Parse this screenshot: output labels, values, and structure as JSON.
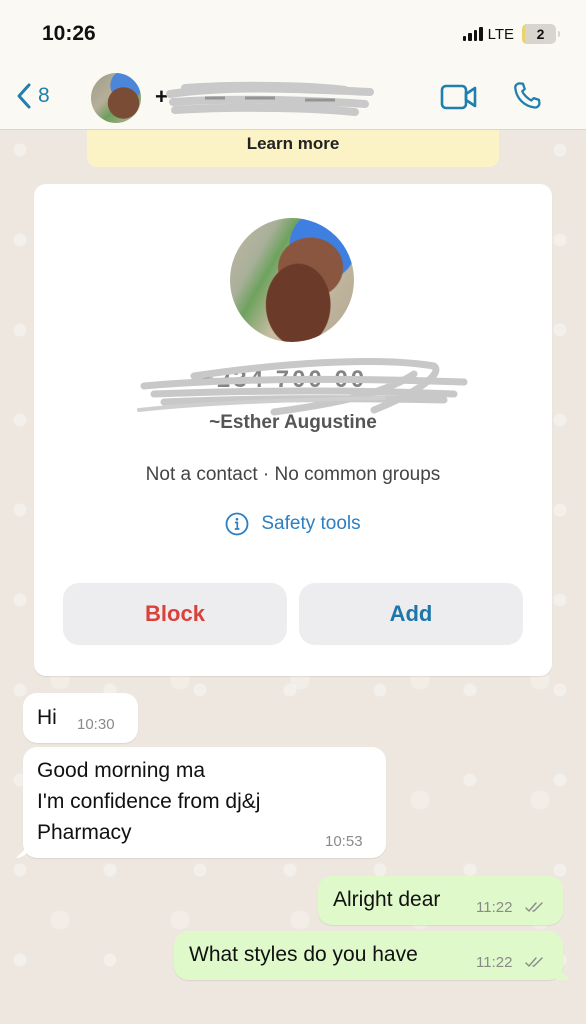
{
  "status_bar": {
    "time": "10:26",
    "network": "LTE",
    "battery_label": "2"
  },
  "header": {
    "back_count": "8",
    "contact_number_visible_prefix": "+",
    "contact_number_redacted_hint": "234 700 ··· ···",
    "accent_color": "#1F7FAE"
  },
  "banner": {
    "learn_more": "Learn more"
  },
  "contact_card": {
    "number_redacted_hint": "+234 700 00 ···",
    "name": "~Esther Augustine",
    "subtitle": "Not a contact · No common groups",
    "safety_tools": "Safety tools",
    "block_label": "Block",
    "add_label": "Add"
  },
  "messages": [
    {
      "direction": "in",
      "text": "Hi",
      "time": "10:30"
    },
    {
      "direction": "in",
      "lines": [
        "Good morning ma",
        "I'm confidence from dj&j",
        "Pharmacy"
      ],
      "time": "10:53"
    },
    {
      "direction": "out",
      "text": "Alright dear",
      "time": "11:22",
      "status": "read-double-check"
    },
    {
      "direction": "out",
      "text": "What styles do you have",
      "time": "11:22",
      "status": "read-double-check"
    }
  ]
}
